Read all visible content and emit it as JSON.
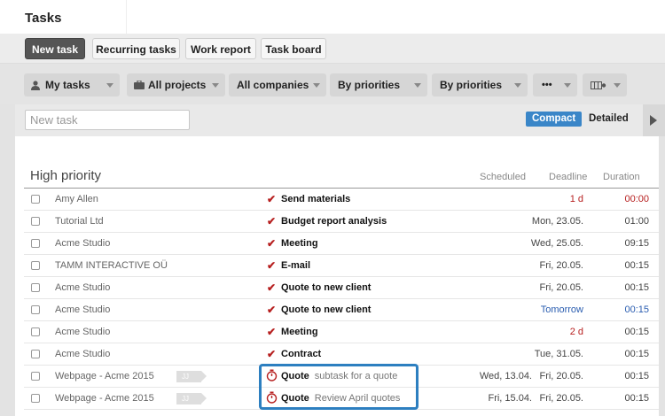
{
  "app": {
    "title": "Tasks"
  },
  "tabs": [
    {
      "label": "New task",
      "active": true
    },
    {
      "label": "Recurring tasks",
      "active": false
    },
    {
      "label": "Work report",
      "active": false
    },
    {
      "label": "Task board",
      "active": false
    }
  ],
  "filters": {
    "my_tasks": {
      "label": "My tasks",
      "icon": "person-icon"
    },
    "projects": {
      "label": "All projects",
      "icon": "briefcase-icon"
    },
    "companies": {
      "label": "All companies"
    },
    "priorities1": {
      "label": "By priorities"
    },
    "priorities2": {
      "label": "By priorities"
    },
    "more": {
      "label": "•••"
    },
    "columns": {
      "icon": "columns-settings-icon"
    }
  },
  "new_task": {
    "placeholder": "New task"
  },
  "view": {
    "compact": "Compact",
    "detailed": "Detailed"
  },
  "group": {
    "title": "High priority",
    "columns": {
      "scheduled": "Scheduled",
      "deadline": "Deadline",
      "duration": "Duration"
    }
  },
  "rows": [
    {
      "company": "Amy Allen",
      "name": "Send materials",
      "sub": "",
      "scheduled": "",
      "deadline": "1 d",
      "duration": "00:00",
      "icon": "check",
      "deadline_color": "red",
      "duration_color": "red",
      "tag": ""
    },
    {
      "company": "Tutorial Ltd",
      "name": "Budget report analysis",
      "sub": "",
      "scheduled": "",
      "deadline": "Mon, 23.05.",
      "duration": "01:00",
      "icon": "check",
      "deadline_color": "",
      "duration_color": "",
      "tag": ""
    },
    {
      "company": "Acme Studio",
      "name": "Meeting",
      "sub": "",
      "scheduled": "",
      "deadline": "Wed, 25.05.",
      "duration": "09:15",
      "icon": "check",
      "deadline_color": "",
      "duration_color": "",
      "tag": ""
    },
    {
      "company": "TAMM INTERACTIVE OÜ",
      "name": "E-mail",
      "sub": "",
      "scheduled": "",
      "deadline": "Fri, 20.05.",
      "duration": "00:15",
      "icon": "check",
      "deadline_color": "",
      "duration_color": "",
      "tag": ""
    },
    {
      "company": "Acme Studio",
      "name": "Quote to new client",
      "sub": "",
      "scheduled": "",
      "deadline": "Fri, 20.05.",
      "duration": "00:15",
      "icon": "check",
      "deadline_color": "",
      "duration_color": "",
      "tag": ""
    },
    {
      "company": "Acme Studio",
      "name": "Quote to new client",
      "sub": "",
      "scheduled": "",
      "deadline": "Tomorrow",
      "duration": "00:15",
      "icon": "check",
      "deadline_color": "blue",
      "duration_color": "blue",
      "tag": ""
    },
    {
      "company": "Acme Studio",
      "name": "Meeting",
      "sub": "",
      "scheduled": "",
      "deadline": "2 d",
      "duration": "00:15",
      "icon": "check",
      "deadline_color": "red",
      "duration_color": "",
      "tag": ""
    },
    {
      "company": "Acme Studio",
      "name": "Contract",
      "sub": "",
      "scheduled": "",
      "deadline": "Tue, 31.05.",
      "duration": "00:15",
      "icon": "check",
      "deadline_color": "",
      "duration_color": "",
      "tag": ""
    },
    {
      "company": "Webpage - Acme 2015",
      "name": "Quote",
      "sub": "subtask for a quote",
      "scheduled": "Wed, 13.04.",
      "deadline": "Fri, 20.05.",
      "duration": "00:15",
      "icon": "timer",
      "deadline_color": "",
      "duration_color": "",
      "tag": "JJ"
    },
    {
      "company": "Webpage - Acme 2015",
      "name": "Quote",
      "sub": "Review April quotes",
      "scheduled": "Fri, 15.04.",
      "deadline": "Fri, 20.05.",
      "duration": "00:15",
      "icon": "timer",
      "deadline_color": "",
      "duration_color": "",
      "tag": "JJ"
    }
  ]
}
